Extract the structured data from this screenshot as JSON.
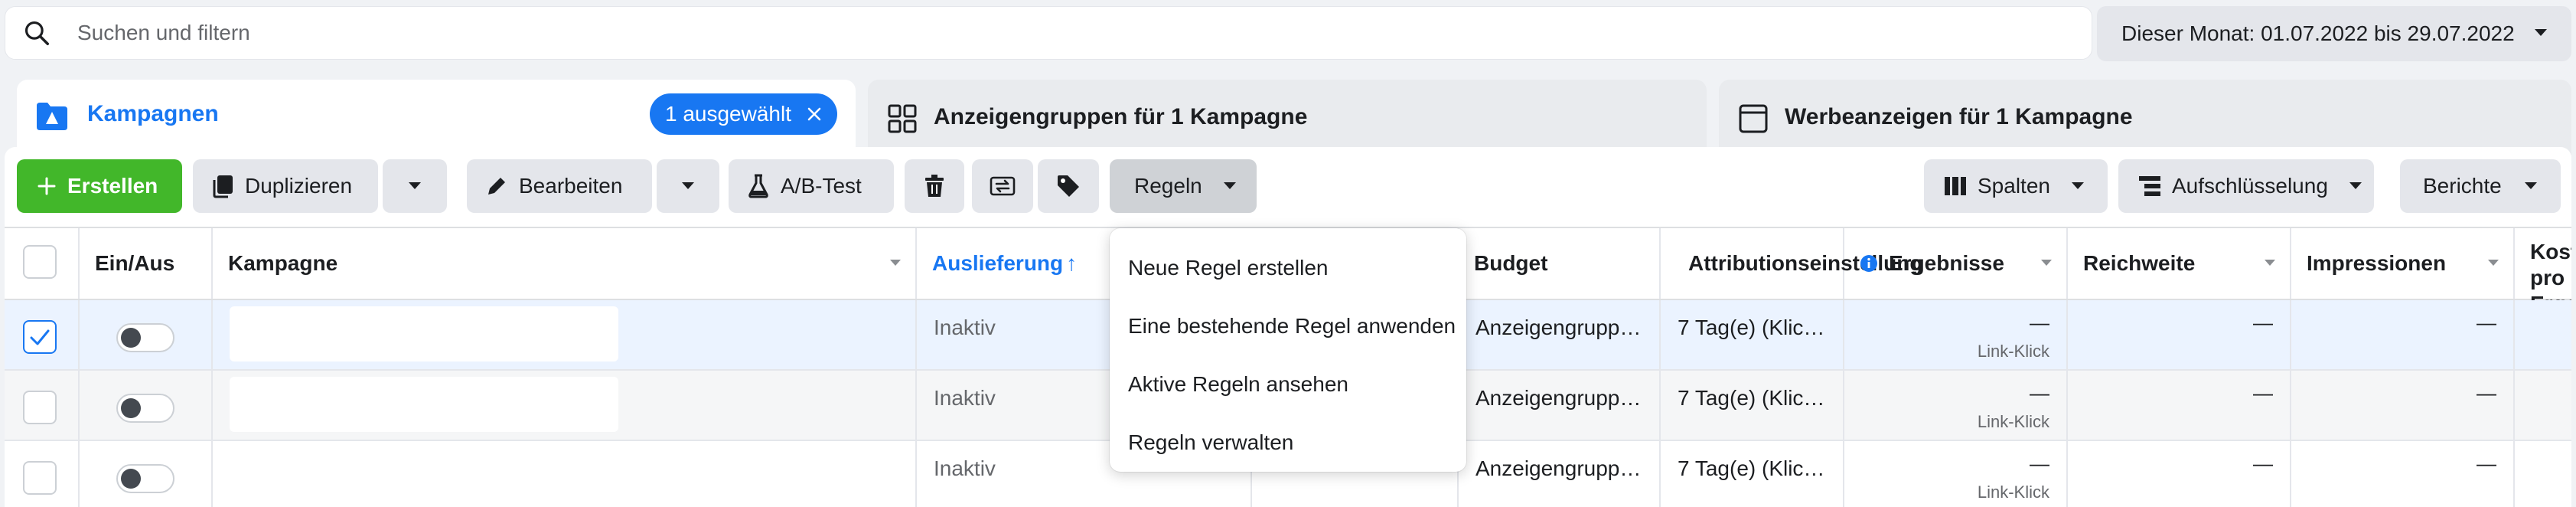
{
  "search": {
    "placeholder": "Suchen und filtern"
  },
  "date_range": {
    "label": "Dieser Monat: 01.07.2022 bis 29.07.2022"
  },
  "tabs": [
    {
      "label": "Kampagnen",
      "badge": "1 ausgewählt"
    },
    {
      "label": "Anzeigengruppen für 1 Kampagne"
    },
    {
      "label": "Werbeanzeigen für 1 Kampagne"
    }
  ],
  "toolbar": {
    "create": "Erstellen",
    "duplicate": "Duplizieren",
    "edit": "Bearbeiten",
    "ab_test": "A/B-Test",
    "rules": "Regeln",
    "columns": "Spalten",
    "breakdown": "Aufschlüsselung",
    "reports": "Berichte"
  },
  "columns": {
    "onoff": "Ein/Aus",
    "campaign": "Kampagne",
    "delivery": "Auslieferung",
    "delivery_sort": "↑",
    "budget": "Budget",
    "attribution": "Attributionseinstellung",
    "results": "Ergebnisse",
    "reach": "Reichweite",
    "impressions": "Impressionen",
    "cost": "Kosten pro Ergebnis"
  },
  "rows": [
    {
      "selected": true,
      "delivery": "Inaktiv",
      "budget": "Anzeigengrupp…",
      "attribution": "7 Tag(e) (Klic…",
      "results": "—",
      "results_sub": "Link-Klick",
      "reach": "—",
      "impressions": "—"
    },
    {
      "selected": false,
      "delivery": "Inaktiv",
      "budget": "Anzeigengrupp…",
      "attribution": "7 Tag(e) (Klic…",
      "results": "—",
      "results_sub": "Link-Klick",
      "reach": "—",
      "impressions": "—"
    },
    {
      "selected": false,
      "delivery": "Inaktiv",
      "budget": "Anzeigengrupp…",
      "attribution": "7 Tag(e) (Klic…",
      "results": "—",
      "results_sub": "Link-Klick",
      "reach": "—",
      "impressions": "—"
    }
  ],
  "rules_menu": [
    "Neue Regel erstellen",
    "Eine bestehende Regel anwenden",
    "Aktive Regeln ansehen",
    "Regeln verwalten"
  ],
  "colors": {
    "accent": "#1877f2",
    "create": "#42b72a",
    "selected_row": "#ebf3ff"
  }
}
